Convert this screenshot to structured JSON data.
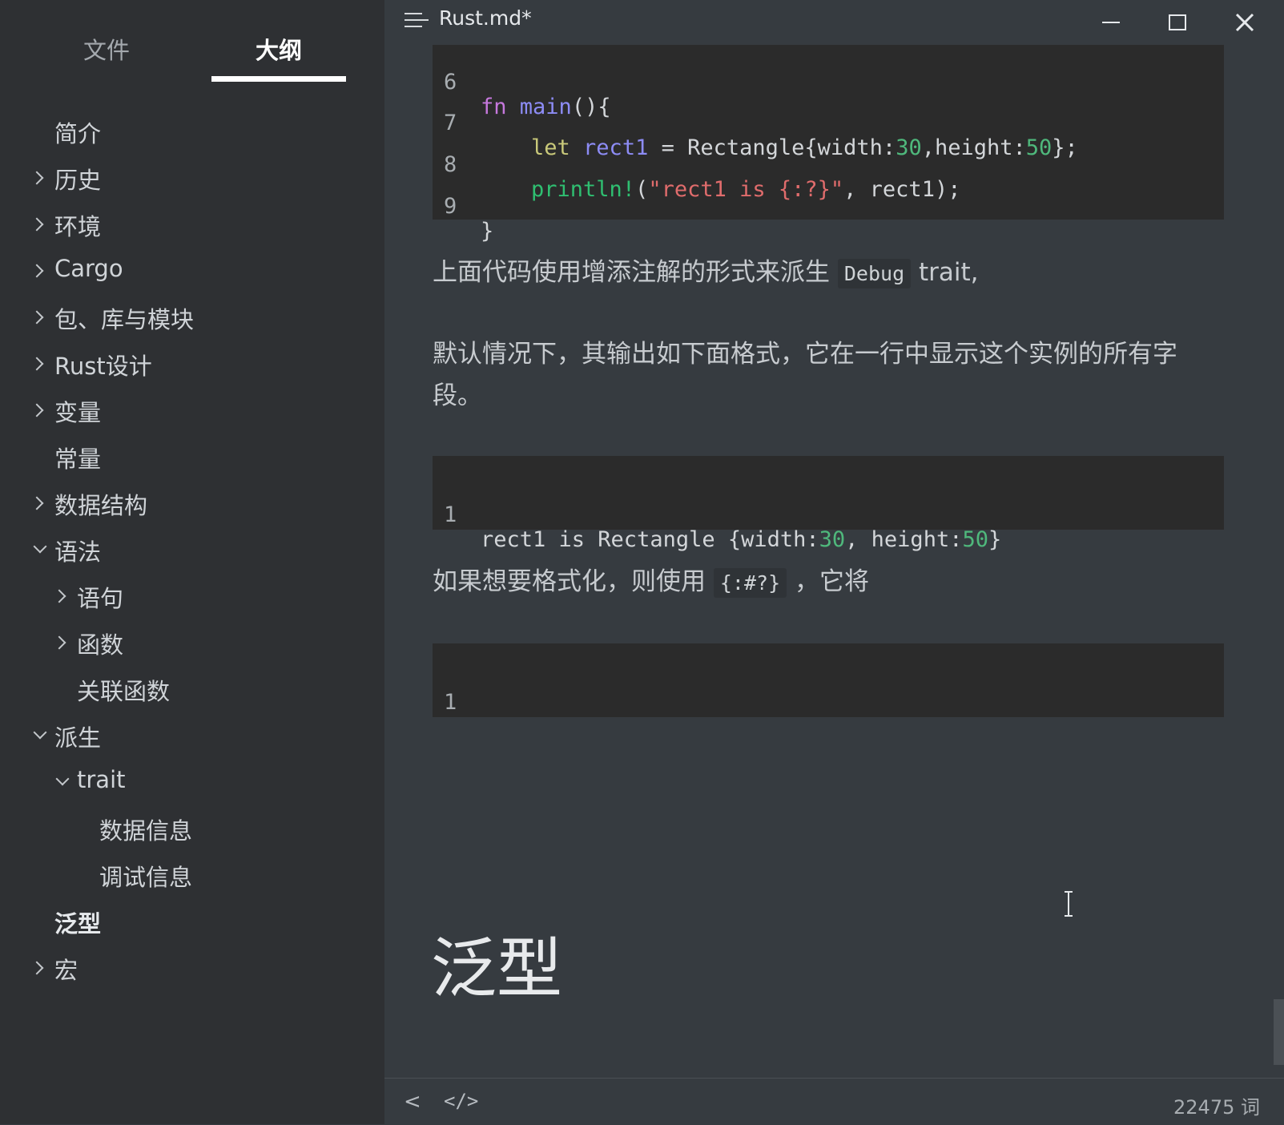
{
  "sidebar": {
    "tabs": {
      "files": "文件",
      "outline": "大纲"
    },
    "items": [
      {
        "label": "简介"
      },
      {
        "label": "历史"
      },
      {
        "label": "环境"
      },
      {
        "label": "Cargo"
      },
      {
        "label": "包、库与模块"
      },
      {
        "label": "Rust设计"
      },
      {
        "label": "变量"
      },
      {
        "label": "常量"
      },
      {
        "label": "数据结构"
      },
      {
        "label": "语法"
      },
      {
        "label": "语句"
      },
      {
        "label": "函数"
      },
      {
        "label": "关联函数"
      },
      {
        "label": "派生"
      },
      {
        "label": "trait"
      },
      {
        "label": "数据信息"
      },
      {
        "label": "调试信息"
      },
      {
        "label": "泛型"
      },
      {
        "label": "宏"
      }
    ]
  },
  "window": {
    "title": "Rust.md*"
  },
  "editor": {
    "code1": {
      "lines": [
        {
          "n": "6",
          "t": [
            "fn",
            " ",
            "main",
            "(){"
          ]
        },
        {
          "n": "7",
          "t": [
            "let",
            " ",
            "rect1",
            " = Rectangle{width:",
            "30",
            ",height:",
            "50",
            "};"
          ]
        },
        {
          "n": "8",
          "t": [
            "println!",
            "(",
            "\"rect1 is {:?}\"",
            ", rect1);"
          ]
        },
        {
          "n": "9",
          "t": [
            "}"
          ]
        }
      ]
    },
    "para1": {
      "before": "上面代码使用增添注解的形式来派生 ",
      "code": "Debug",
      "after": " trait,"
    },
    "para2": "默认情况下，其输出如下面格式，它在一行中显示这个实例的所有字段。",
    "code2": {
      "n": "1",
      "t": [
        "rect1 is Rectangle {width:",
        "30",
        ", height:",
        "50",
        "}"
      ]
    },
    "para3": {
      "before": "如果想要格式化，则使用 ",
      "code": "{:#?}",
      "after": " ，它将"
    },
    "code3": {
      "n": "1"
    },
    "heading": "泛型"
  },
  "statusbar": {
    "back": "<",
    "code_toggle": "</>",
    "word_count": "22475 词"
  }
}
